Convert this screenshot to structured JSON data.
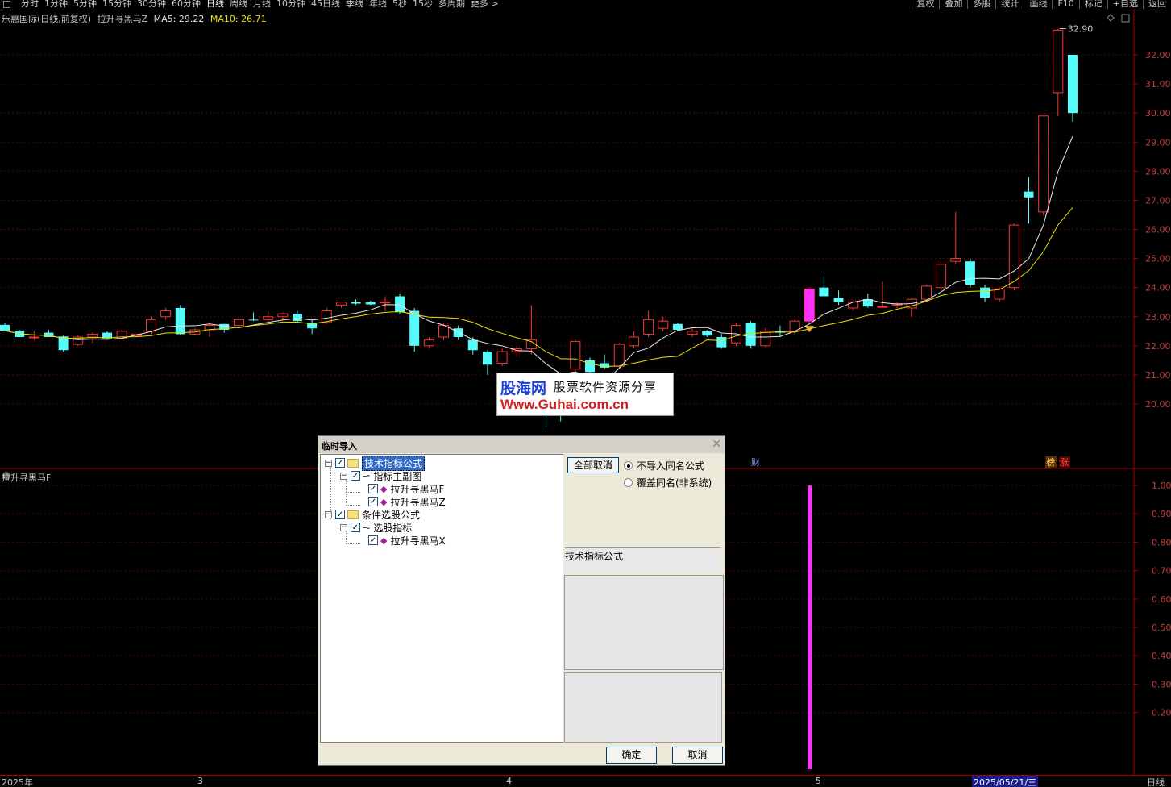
{
  "toolbar": {
    "periods": [
      "分时",
      "1分钟",
      "5分钟",
      "15分钟",
      "30分钟",
      "60分钟",
      "日线",
      "周线",
      "月线",
      "10分钟",
      "45日线",
      "季线",
      "年线",
      "5秒",
      "15秒",
      "多周期",
      "更多 >"
    ],
    "active_period": "日线",
    "tools": [
      "复权",
      "叠加",
      "多股",
      "统计",
      "画线",
      "F10",
      "标记",
      "+自选",
      "返回"
    ]
  },
  "header": {
    "stock": "乐惠国际(日线,前复权)",
    "indicator": "拉升寻黑马Z",
    "ma5": "MA5: 29.22",
    "ma10": "MA10: 26.71"
  },
  "subchart": {
    "title": "拉升寻黑马F"
  },
  "main_chart": {
    "price_ticks": [
      "32.00",
      "31.00",
      "30.00",
      "29.00",
      "28.00",
      "27.00",
      "26.00",
      "25.00",
      "24.00",
      "23.00",
      "22.00",
      "21.00",
      "20.00"
    ],
    "high_label": "32.90",
    "badge_cai": "财",
    "badge_bang": "榜",
    "badge_zhang": "涨"
  },
  "sub_ticks": [
    "1.00",
    "0.90",
    "0.80",
    "0.70",
    "0.60",
    "0.50",
    "0.40",
    "0.30",
    "0.20"
  ],
  "watermark": {
    "logo": "股海网",
    "tagline": "股票软件资源分享",
    "url": "Www.Guhai.com.cn"
  },
  "dialog": {
    "title": "临时导入",
    "tree": {
      "root1": "技术指标公式",
      "group1": "指标主副图",
      "item1": "拉升寻黑马F",
      "item2": "拉升寻黑马Z",
      "root2": "条件选股公式",
      "group2": "选股指标",
      "item3": "拉升寻黑马X"
    },
    "cancel_all": "全部取消",
    "radio1": "不导入同名公式",
    "radio2": "覆盖同名(非系统)",
    "info_label": "技术指标公式",
    "ok": "确定",
    "cancel": "取消"
  },
  "bottom": {
    "year": "2025年",
    "m3": "3",
    "m4": "4",
    "m5": "5",
    "date": "2025/05/21/三",
    "period": "日线"
  },
  "chart_data": {
    "type": "candlestick",
    "ylim": [
      19.5,
      33.2
    ],
    "candles": [
      {
        "o": 22.72,
        "h": 22.8,
        "l": 22.55,
        "c": 22.52
      },
      {
        "o": 22.52,
        "h": 22.55,
        "l": 22.3,
        "c": 22.3
      },
      {
        "o": 22.3,
        "h": 22.5,
        "l": 22.2,
        "c": 22.3
      },
      {
        "o": 22.45,
        "h": 22.55,
        "l": 22.3,
        "c": 22.3
      },
      {
        "o": 22.32,
        "h": 22.35,
        "l": 21.8,
        "c": 21.85
      },
      {
        "o": 22.05,
        "h": 22.35,
        "l": 22.0,
        "c": 22.3
      },
      {
        "o": 22.3,
        "h": 22.45,
        "l": 22.1,
        "c": 22.4
      },
      {
        "o": 22.45,
        "h": 22.5,
        "l": 22.2,
        "c": 22.25
      },
      {
        "o": 22.25,
        "h": 22.55,
        "l": 22.2,
        "c": 22.5
      },
      {
        "o": 22.35,
        "h": 22.4,
        "l": 22.3,
        "c": 22.4
      },
      {
        "o": 22.5,
        "h": 23.0,
        "l": 22.4,
        "c": 22.9
      },
      {
        "o": 23.0,
        "h": 23.3,
        "l": 22.9,
        "c": 23.2
      },
      {
        "o": 23.3,
        "h": 23.4,
        "l": 22.35,
        "c": 22.4
      },
      {
        "o": 22.4,
        "h": 22.6,
        "l": 22.35,
        "c": 22.55
      },
      {
        "o": 22.55,
        "h": 22.8,
        "l": 22.3,
        "c": 22.7
      },
      {
        "o": 22.75,
        "h": 22.75,
        "l": 22.45,
        "c": 22.55
      },
      {
        "o": 22.7,
        "h": 23.0,
        "l": 22.6,
        "c": 22.9
      },
      {
        "o": 22.9,
        "h": 23.15,
        "l": 22.85,
        "c": 22.88
      },
      {
        "o": 22.9,
        "h": 23.2,
        "l": 22.85,
        "c": 23.0
      },
      {
        "o": 23.0,
        "h": 23.15,
        "l": 22.9,
        "c": 23.1
      },
      {
        "o": 23.1,
        "h": 23.2,
        "l": 22.8,
        "c": 22.85
      },
      {
        "o": 22.8,
        "h": 22.9,
        "l": 22.4,
        "c": 22.6
      },
      {
        "o": 22.8,
        "h": 23.3,
        "l": 22.75,
        "c": 23.2
      },
      {
        "o": 23.4,
        "h": 23.5,
        "l": 23.3,
        "c": 23.5
      },
      {
        "o": 23.5,
        "h": 23.6,
        "l": 23.4,
        "c": 23.45
      },
      {
        "o": 23.5,
        "h": 23.55,
        "l": 23.4,
        "c": 23.42
      },
      {
        "o": 23.5,
        "h": 23.7,
        "l": 23.2,
        "c": 23.5
      },
      {
        "o": 23.7,
        "h": 23.8,
        "l": 23.1,
        "c": 23.15
      },
      {
        "o": 23.2,
        "h": 23.3,
        "l": 21.8,
        "c": 22.0
      },
      {
        "o": 22.0,
        "h": 22.3,
        "l": 21.9,
        "c": 22.2
      },
      {
        "o": 22.3,
        "h": 22.8,
        "l": 22.2,
        "c": 22.7
      },
      {
        "o": 22.6,
        "h": 22.7,
        "l": 22.2,
        "c": 22.3
      },
      {
        "o": 22.2,
        "h": 22.3,
        "l": 21.7,
        "c": 21.85
      },
      {
        "o": 21.8,
        "h": 21.85,
        "l": 21.0,
        "c": 21.35
      },
      {
        "o": 21.4,
        "h": 21.9,
        "l": 21.3,
        "c": 21.8
      },
      {
        "o": 21.8,
        "h": 22.0,
        "l": 21.6,
        "c": 21.9
      },
      {
        "o": 21.9,
        "h": 23.4,
        "l": 21.7,
        "c": 22.2
      },
      {
        "o": 20.5,
        "h": 20.6,
        "l": 19.1,
        "c": 19.65
      },
      {
        "o": 19.65,
        "h": 20.0,
        "l": 19.4,
        "c": 19.6
      },
      {
        "o": 21.2,
        "h": 22.2,
        "l": 21.0,
        "c": 22.15
      },
      {
        "o": 21.5,
        "h": 21.6,
        "l": 21.0,
        "c": 21.1
      },
      {
        "o": 21.4,
        "h": 21.7,
        "l": 21.2,
        "c": 21.25
      },
      {
        "o": 21.3,
        "h": 22.1,
        "l": 21.2,
        "c": 22.05
      },
      {
        "o": 22.0,
        "h": 22.5,
        "l": 21.9,
        "c": 22.3
      },
      {
        "o": 22.4,
        "h": 23.2,
        "l": 22.3,
        "c": 22.9
      },
      {
        "o": 22.6,
        "h": 23.0,
        "l": 22.5,
        "c": 22.85
      },
      {
        "o": 22.75,
        "h": 22.8,
        "l": 22.5,
        "c": 22.55
      },
      {
        "o": 22.4,
        "h": 22.6,
        "l": 22.3,
        "c": 22.5
      },
      {
        "o": 22.5,
        "h": 22.55,
        "l": 22.3,
        "c": 22.35
      },
      {
        "o": 22.3,
        "h": 22.4,
        "l": 21.9,
        "c": 21.95
      },
      {
        "o": 22.1,
        "h": 22.8,
        "l": 22.0,
        "c": 22.7
      },
      {
        "o": 22.8,
        "h": 22.85,
        "l": 21.9,
        "c": 22.0
      },
      {
        "o": 22.0,
        "h": 22.6,
        "l": 21.95,
        "c": 22.5
      },
      {
        "o": 22.5,
        "h": 22.7,
        "l": 22.3,
        "c": 22.45
      },
      {
        "o": 22.5,
        "h": 22.9,
        "l": 22.4,
        "c": 22.85
      },
      {
        "o": 22.85,
        "h": 24.0,
        "l": 22.8,
        "c": 23.95
      },
      {
        "o": 24.0,
        "h": 24.4,
        "l": 23.8,
        "c": 23.7
      },
      {
        "o": 23.65,
        "h": 23.9,
        "l": 23.4,
        "c": 23.5
      },
      {
        "o": 23.3,
        "h": 23.6,
        "l": 23.2,
        "c": 23.5
      },
      {
        "o": 23.6,
        "h": 23.8,
        "l": 23.3,
        "c": 23.35
      },
      {
        "o": 23.35,
        "h": 24.2,
        "l": 23.3,
        "c": 23.35
      },
      {
        "o": 23.4,
        "h": 23.5,
        "l": 23.3,
        "c": 23.45
      },
      {
        "o": 23.3,
        "h": 23.65,
        "l": 23.0,
        "c": 23.6
      },
      {
        "o": 23.6,
        "h": 24.1,
        "l": 23.5,
        "c": 24.05
      },
      {
        "o": 24.0,
        "h": 24.9,
        "l": 23.9,
        "c": 24.8
      },
      {
        "o": 24.9,
        "h": 26.6,
        "l": 24.8,
        "c": 25.0
      },
      {
        "o": 24.9,
        "h": 25.0,
        "l": 24.0,
        "c": 24.1
      },
      {
        "o": 24.0,
        "h": 24.1,
        "l": 23.5,
        "c": 23.65
      },
      {
        "o": 23.6,
        "h": 24.0,
        "l": 23.5,
        "c": 23.95
      },
      {
        "o": 24.0,
        "h": 26.2,
        "l": 23.9,
        "c": 26.15
      },
      {
        "o": 27.3,
        "h": 27.8,
        "l": 26.2,
        "c": 27.1
      },
      {
        "o": 26.6,
        "h": 29.9,
        "l": 26.5,
        "c": 29.9
      },
      {
        "o": 30.7,
        "h": 32.9,
        "l": 29.9,
        "c": 32.85
      },
      {
        "o": 32.0,
        "h": 32.0,
        "l": 29.7,
        "c": 30.0
      }
    ],
    "indicator_bars": [
      {
        "index": 55,
        "value": 1.0
      }
    ]
  }
}
